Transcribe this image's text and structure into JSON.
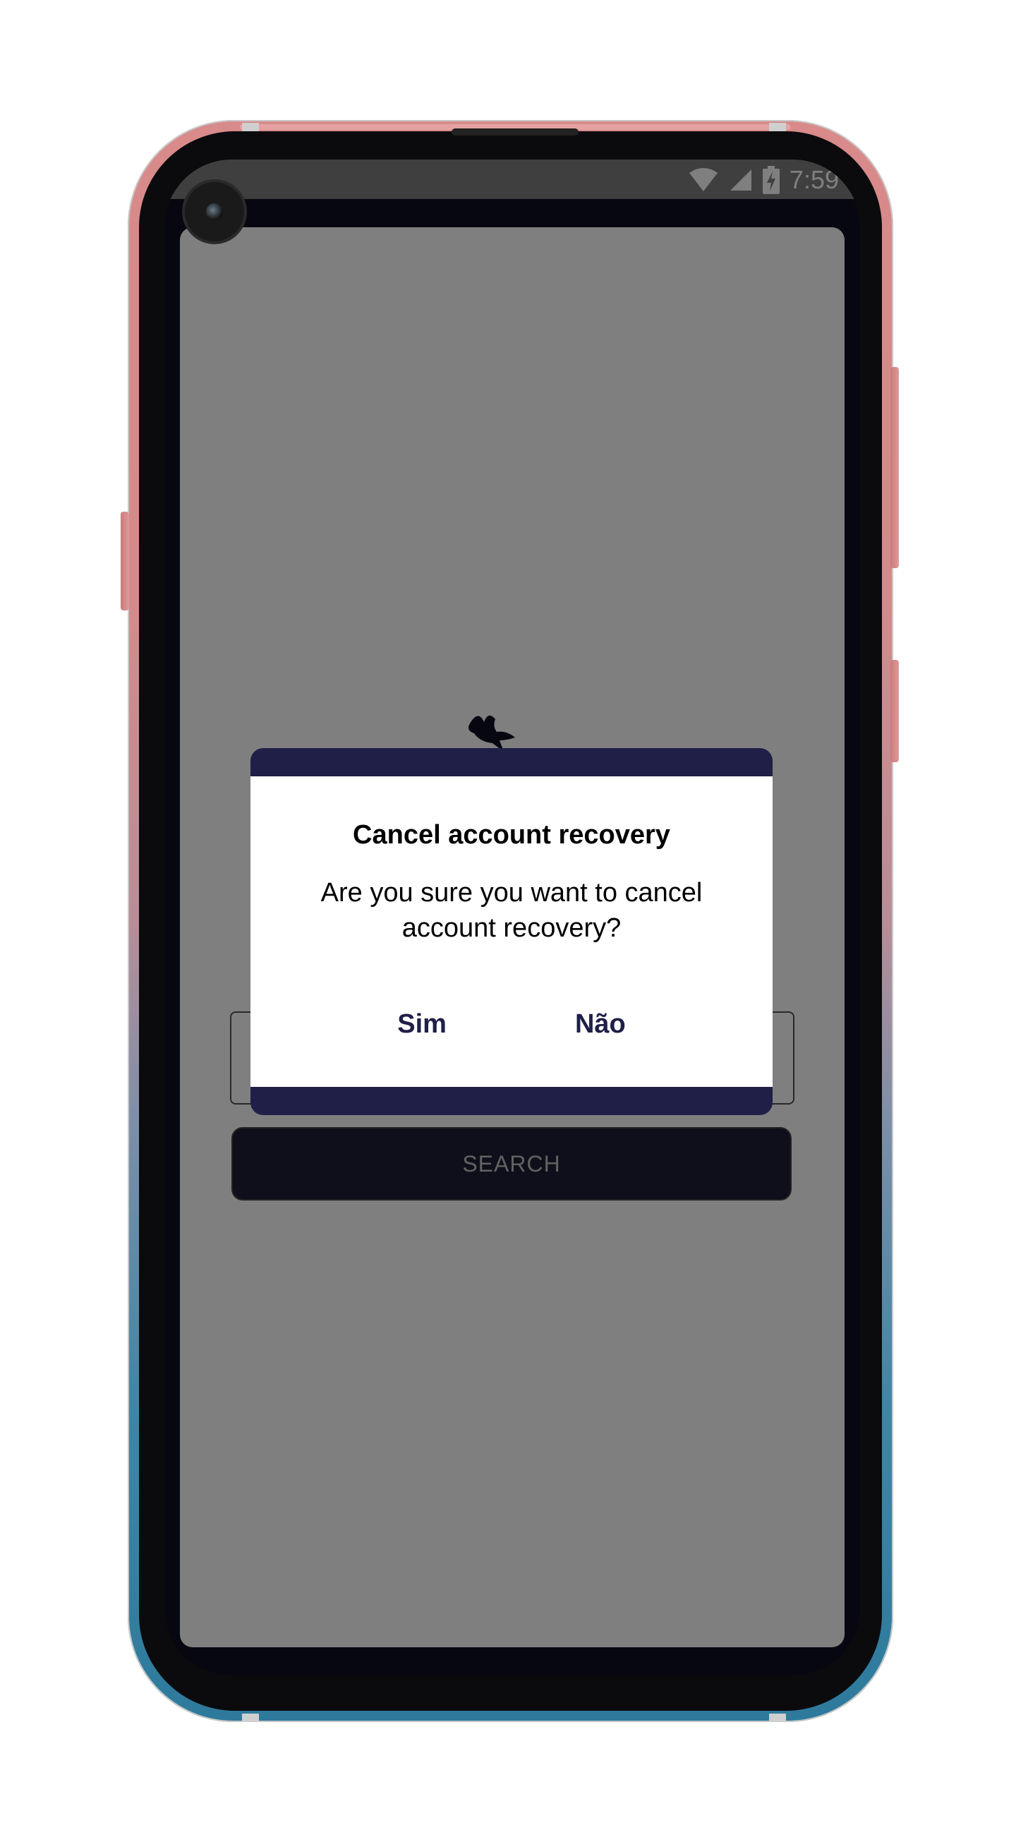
{
  "status_bar": {
    "time": "7:59",
    "icons": [
      "wifi-icon",
      "cell-signal-icon",
      "battery-charging-icon"
    ]
  },
  "background_screen": {
    "logo_icon": "bird-logo-icon",
    "search_button_label": "SEARCH"
  },
  "dialog": {
    "title": "Cancel account recovery",
    "message": "Are you sure you want to cancel account recovery?",
    "confirm_label": "Sim",
    "cancel_label": "Não"
  },
  "colors": {
    "dialog_accent": "#1f1f47",
    "scrim": "#7f7f7f",
    "screen_frame": "#0f0f22"
  }
}
